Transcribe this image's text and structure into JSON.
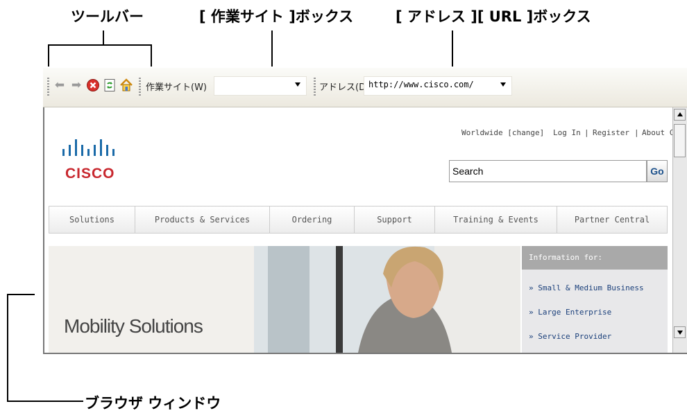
{
  "callouts": {
    "toolbar": "ツールバー",
    "work_site_box": "[ 作業サイト ]ボックス",
    "address_box": "[ アドレス ][ URL ]ボックス",
    "browser_window": "ブラウザ ウィンドウ"
  },
  "toolbar": {
    "icons": [
      "back-arrow-icon",
      "forward-arrow-icon",
      "stop-icon",
      "refresh-icon",
      "home-icon"
    ],
    "work_site_label": "作業サイト(W)",
    "work_site_value": "",
    "address_label": "アドレス(D)",
    "address_value": "http://www.cisco.com/"
  },
  "page": {
    "logo_text": "CISCO",
    "worldwide": "Worldwide [change]",
    "log_in": "Log In",
    "register": "Register",
    "about": "About Cisco",
    "sep": "|",
    "search_value": "Search",
    "go_label": "Go",
    "nav": [
      "Solutions",
      "Products & Services",
      "Ordering",
      "Support",
      "Training & Events",
      "Partner Central"
    ],
    "hero_title": "Mobility Solutions",
    "info_heading": "Information for:",
    "info_links": [
      "» Small & Medium Business",
      "» Large Enterprise",
      "» Service Provider"
    ]
  },
  "colors": {
    "cisco_red": "#c8272e",
    "link_blue": "#1a3f7a",
    "info_header": "#a9a9a9"
  }
}
